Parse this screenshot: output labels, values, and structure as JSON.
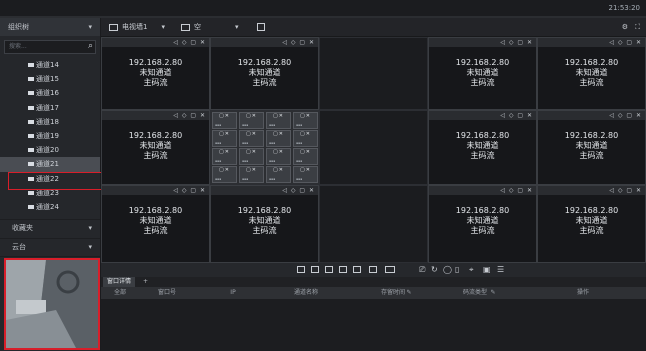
{
  "window": {
    "title": "",
    "clock": "21:53:20"
  },
  "sidebar": {
    "header": "组织树",
    "search_placeholder": "搜索...",
    "channels": [
      "通道14",
      "通道15",
      "通道16",
      "通道17",
      "通道18",
      "通道19",
      "通道20",
      "通道21",
      "通道22",
      "通道23",
      "通道24"
    ],
    "selected_channel": "通道21",
    "sections": [
      "收藏夹",
      "云台",
      "预览"
    ]
  },
  "toolbar": {
    "monitor": "电视墙1",
    "layout": "空"
  },
  "cells": [
    {
      "ip": "192.168.2.80",
      "status": "未知通道",
      "stream": "主码流"
    },
    {
      "ip": "192.168.2.80",
      "status": "未知通道",
      "stream": "主码流"
    },
    {
      "ip": "192.168.2.80",
      "status": "未知通道",
      "stream": "主码流"
    },
    {
      "ip": "192.168.2.80",
      "status": "未知通道",
      "stream": "主码流"
    },
    {
      "ip": "192.168.2.80",
      "status": "未知通道",
      "stream": "主码流"
    },
    {
      "ip": "192.168.2.80",
      "status": "未知通道",
      "stream": "主码流"
    },
    {
      "ip": "192.168.2.80",
      "status": "未知通道",
      "stream": "主码流"
    },
    {
      "ip": "192.168.2.80",
      "status": "未知通道",
      "stream": "主码流"
    },
    {
      "ip": "192.168.2.80",
      "status": "未知通道",
      "stream": "主码流"
    },
    {
      "ip": "192.168.2.80",
      "status": "未知通道",
      "stream": "主码流"
    },
    {
      "ip": "192.168.2.80",
      "status": "未知通道",
      "stream": "主码流"
    }
  ],
  "window_panel": {
    "tab_label": "窗口详情",
    "add_tab": "+",
    "columns": [
      "全部",
      "窗口号",
      "IP",
      "通道名称",
      "存留时间",
      "码流类型",
      "操作"
    ]
  },
  "colors": {
    "accent_red": "#d81e2a",
    "cell_bg": "#16171a"
  }
}
